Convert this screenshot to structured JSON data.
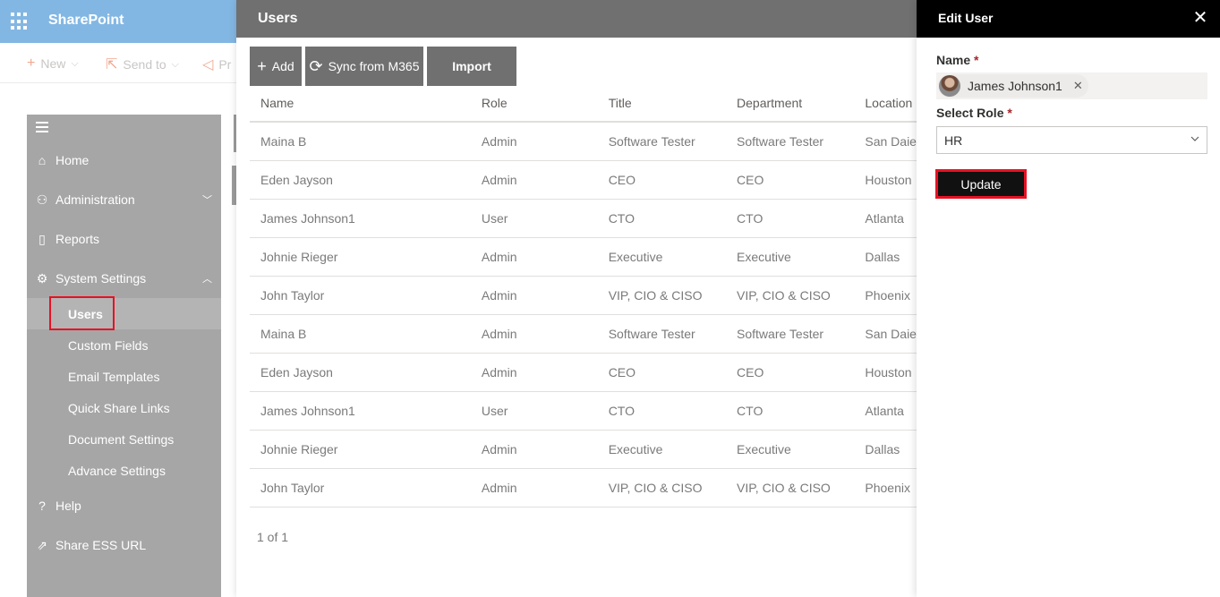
{
  "suite": {
    "title": "SharePoint"
  },
  "command_bar": {
    "new_label": "New",
    "send_to_label": "Send to",
    "promote_label": "Pr"
  },
  "nav": {
    "home": "Home",
    "administration": "Administration",
    "reports": "Reports",
    "system_settings": "System Settings",
    "sub_items": [
      "Users",
      "Custom Fields",
      "Email Templates",
      "Quick Share Links",
      "Document Settings",
      "Advance Settings"
    ],
    "help": "Help",
    "share_ess_url": "Share ESS URL"
  },
  "users_panel": {
    "title": "Users",
    "toolbar": {
      "add": "Add",
      "sync": "Sync from M365",
      "import": "Import"
    },
    "columns": [
      "Name",
      "Role",
      "Title",
      "Department",
      "Location"
    ],
    "rows": [
      [
        "Maina B",
        "Admin",
        "Software Tester",
        "Software Tester",
        "San Daie"
      ],
      [
        "Eden Jayson",
        "Admin",
        "CEO",
        "CEO",
        "Houston"
      ],
      [
        "James Johnson1",
        "User",
        "CTO",
        "CTO",
        "Atlanta"
      ],
      [
        "Johnie Rieger",
        "Admin",
        "Executive",
        "Executive",
        "Dallas"
      ],
      [
        "John Taylor",
        "Admin",
        "VIP, CIO & CISO",
        "VIP, CIO & CISO",
        "Phoenix"
      ],
      [
        "Maina B",
        "Admin",
        "Software Tester",
        "Software Tester",
        "San Daie"
      ],
      [
        "Eden Jayson",
        "Admin",
        "CEO",
        "CEO",
        "Houston"
      ],
      [
        "James Johnson1",
        "User",
        "CTO",
        "CTO",
        "Atlanta"
      ],
      [
        "Johnie Rieger",
        "Admin",
        "Executive",
        "Executive",
        "Dallas"
      ],
      [
        "John Taylor",
        "Admin",
        "VIP, CIO & CISO",
        "VIP, CIO & CISO",
        "Phoenix"
      ]
    ],
    "pager": "1 of 1"
  },
  "edit_panel": {
    "title": "Edit User",
    "name_label": "Name",
    "required_mark": "*",
    "selected_person": "James Johnson1",
    "role_label": "Select Role",
    "role_value": "HR",
    "update_label": "Update"
  },
  "colors": {
    "suite_bar": "#83b7e3",
    "panel_header": "#707070",
    "edit_header": "#000000",
    "highlight": "#e81123"
  }
}
